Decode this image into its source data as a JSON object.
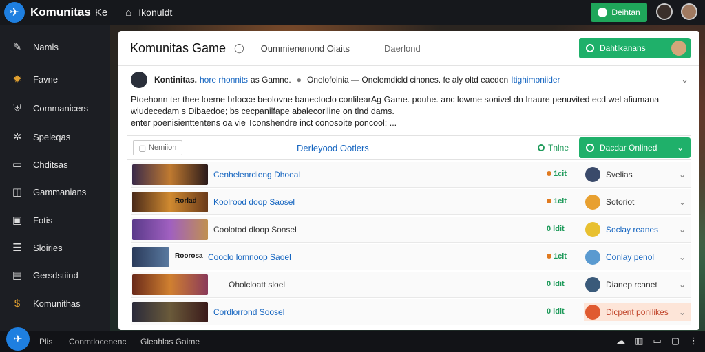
{
  "topbar": {
    "brand": "Komunitas",
    "brand_sub": "Ke",
    "user_label": "Ikonuldt",
    "action_button": "Deihtan"
  },
  "sidebar": {
    "items": [
      {
        "label": "Namls",
        "icon": "feather-icon"
      },
      {
        "label": "Favne",
        "icon": "flame-icon"
      },
      {
        "label": "Commanicers",
        "icon": "shield-icon"
      },
      {
        "label": "Speleqas",
        "icon": "star-icon"
      },
      {
        "label": "Chditsas",
        "icon": "monitor-icon"
      },
      {
        "label": "Gammanians",
        "icon": "grid-icon"
      },
      {
        "label": "Fotis",
        "icon": "photo-icon"
      },
      {
        "label": "Sloiries",
        "icon": "list-icon"
      },
      {
        "label": "Gersdstiind",
        "icon": "settings-icon"
      },
      {
        "label": "Komunithas",
        "icon": "dollar-icon"
      }
    ]
  },
  "panel": {
    "title": "Komunitas Game",
    "subtitle": "Oummienenond Oiaits",
    "tab": "Daerlond",
    "green_button": "Dahtlkanans",
    "post": {
      "author": "Kontinitas.",
      "link": "hore rhonnits",
      "mid": "as Gamne.",
      "summary": "Onelofolnia — Onelemdicld cinones. fe aly oltd eaeden",
      "summary_link": "Itighimoniider"
    },
    "description": [
      "Ptoehonn ter thee loeme brlocce beolovne banectoclo conlilearAg Game. pouhe. anc lowme sonivel dn Inaure penuvited ecd wel afiumana",
      "wiudecedam s Dibaedoe; bs cecpanilfape abalecoriline on tlnd dams.",
      "enter poenisienttentens oa vie Tconshendre inct conosoite poncool; ..."
    ]
  },
  "toolbar": {
    "filter_label": "Nemiion",
    "center_link": "Derleyood Ootlers",
    "status": "Tnlne",
    "dropdown": "Dacdar Onlined"
  },
  "rows": [
    {
      "thumb_label": "",
      "title": "Cenhelenrdieng Dhoeal",
      "count": "1cit",
      "user": "Svelias",
      "highlight": false
    },
    {
      "thumb_label": "Rorlad",
      "title": "Koolrood doop Saosel",
      "count": "1cit",
      "user": "Sotoriot",
      "highlight": false
    },
    {
      "thumb_label": "",
      "title": "Coolotod dloop Sonsel",
      "count": "0 ldit",
      "user": "Soclay reanes",
      "highlight": false
    },
    {
      "thumb_label": "Roorosa",
      "title": "Cooclo lomnoop Saoel",
      "count": "1cit",
      "user": "Conlay penol",
      "highlight": false
    },
    {
      "thumb_label": "",
      "title": "Oholcloatt sloel",
      "count": "0 ldit",
      "user": "Dianep rcanet",
      "highlight": false
    },
    {
      "thumb_label": "",
      "title": "Cordlorrond Soosel",
      "count": "0 ldit",
      "user": "Dicpent ponilikes",
      "highlight": true
    }
  ],
  "bottombar": {
    "item1": "Plis",
    "item2": "Conmtlocenenc",
    "item3": "Gleahlas Gaime"
  },
  "colors": {
    "accent_green": "#1fb06a",
    "link_blue": "#1565c0",
    "brand_blue": "#1e7fe0",
    "highlight_bg": "#fde5d8"
  }
}
